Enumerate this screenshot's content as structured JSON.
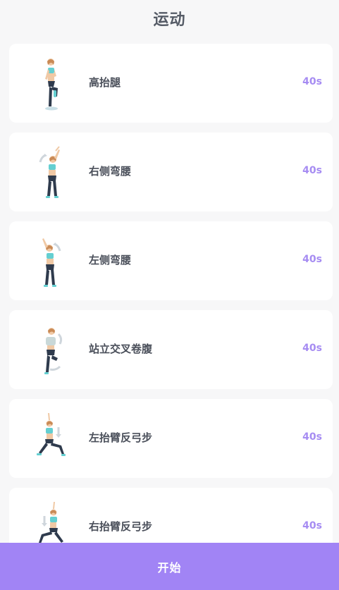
{
  "header": {
    "title": "运动"
  },
  "exercises": [
    {
      "name": "高抬腿",
      "duration": "40s",
      "icon": "high-knees-figure-icon"
    },
    {
      "name": "右侧弯腰",
      "duration": "40s",
      "icon": "right-side-bend-figure-icon"
    },
    {
      "name": "左侧弯腰",
      "duration": "40s",
      "icon": "left-side-bend-figure-icon"
    },
    {
      "name": "站立交叉卷腹",
      "duration": "40s",
      "icon": "standing-cross-crunch-figure-icon"
    },
    {
      "name": "左抬臂反弓步",
      "duration": "40s",
      "icon": "left-arm-reverse-lunge-figure-icon"
    },
    {
      "name": "右抬臂反弓步",
      "duration": "40s",
      "icon": "right-arm-reverse-lunge-figure-icon"
    }
  ],
  "footer": {
    "start_label": "开始"
  },
  "colors": {
    "accent": "#a184f5",
    "duration": "#a68cf2",
    "text": "#4a4f5a",
    "background": "#f7f7f8"
  }
}
